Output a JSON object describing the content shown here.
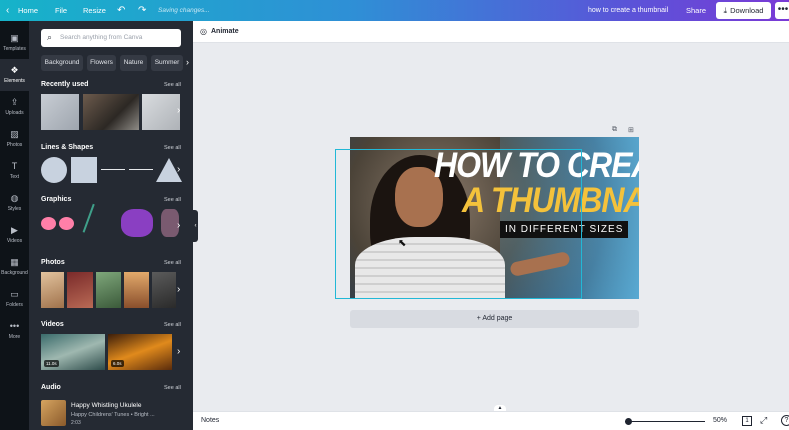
{
  "topbar": {
    "back_icon": "chevron-left-icon",
    "home": "Home",
    "file": "File",
    "resize": "Resize",
    "undo_icon": "undo-icon",
    "redo_icon": "redo-icon",
    "status": "Saving changes...",
    "design_title": "how to create a thumbnail",
    "share": "Share",
    "download": "Download",
    "more": "•••"
  },
  "rail": {
    "items": [
      {
        "label": "Templates",
        "icon": "▣"
      },
      {
        "label": "Elements",
        "icon": "❖"
      },
      {
        "label": "Uploads",
        "icon": "⇪"
      },
      {
        "label": "Photos",
        "icon": "▨"
      },
      {
        "label": "Text",
        "icon": "T"
      },
      {
        "label": "Styles",
        "icon": "◍"
      },
      {
        "label": "Videos",
        "icon": "▶"
      },
      {
        "label": "Background",
        "icon": "▦"
      },
      {
        "label": "Folders",
        "icon": "▭"
      },
      {
        "label": "More",
        "icon": "•••"
      }
    ]
  },
  "panel": {
    "search_placeholder": "Search anything from Canva",
    "chips": [
      "Background",
      "Flowers",
      "Nature",
      "Summer"
    ],
    "sections": {
      "recent": "Recently used",
      "lines": "Lines & Shapes",
      "graphics": "Graphics",
      "photos": "Photos",
      "videos": "Videos",
      "audio": "Audio"
    },
    "see_all": "See all",
    "video_badges": [
      "11.0s",
      "6.0s"
    ],
    "audio": {
      "title": "Happy Whistling Ukulele",
      "artist": "Happy Childrens' Tunes • Bright ...",
      "duration": "2:03"
    }
  },
  "editor": {
    "animate": "Animate",
    "design": {
      "line1": "HOW TO CREATE",
      "line2": "A THUMBNAIL",
      "line3": "IN DIFFERENT SIZES"
    },
    "add_page": "+ Add page"
  },
  "bottombar": {
    "notes": "Notes",
    "zoom": "50%",
    "page": "1",
    "help": "?"
  },
  "colors": {
    "accent": "#22b8d6",
    "headline_yellow": "#f4c23b",
    "panel_bg": "#252a33",
    "rail_bg": "#0e1318"
  }
}
